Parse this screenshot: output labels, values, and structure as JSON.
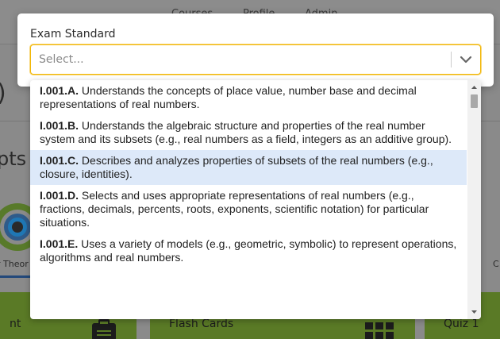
{
  "background": {
    "nav_items": [
      "Courses",
      "Profile",
      "Admin"
    ],
    "partial_paren": ")",
    "partial_heading": "pts",
    "tab_partial_left": "r Theor",
    "tab_partial_right": "C",
    "cards": [
      {
        "label": "nt",
        "icon": "clipboard-icon"
      },
      {
        "label": "Flash Cards",
        "icon": "grid-icon"
      },
      {
        "label": "Quiz 1",
        "icon": ""
      }
    ],
    "card_color": "#5a7a26"
  },
  "modal": {
    "field_label": "Exam Standard",
    "select": {
      "placeholder": "Select...",
      "border_color": "#f2b705"
    }
  },
  "menu": {
    "focused_index": 2,
    "focused_color": "#dde9f9",
    "options": [
      {
        "code": "I.001.A.",
        "text": " Understands the concepts of place value, number base and decimal representations of real numbers."
      },
      {
        "code": "I.001.B.",
        "text": " Understands the algebraic structure and properties of the real number system and its subsets (e.g., real numbers as a field, integers as an additive group)."
      },
      {
        "code": "I.001.C.",
        "text": " Describes and analyzes properties of subsets of the real numbers (e.g., closure, identities)."
      },
      {
        "code": "I.001.D.",
        "text": " Selects and uses appropriate representations of real numbers (e.g., fractions, decimals, percents, roots, exponents, scientific notation) for particular situations."
      },
      {
        "code": "I.001.E.",
        "text": " Uses a variety of models (e.g., geometric, symbolic) to represent operations, algorithms and real numbers."
      }
    ]
  }
}
